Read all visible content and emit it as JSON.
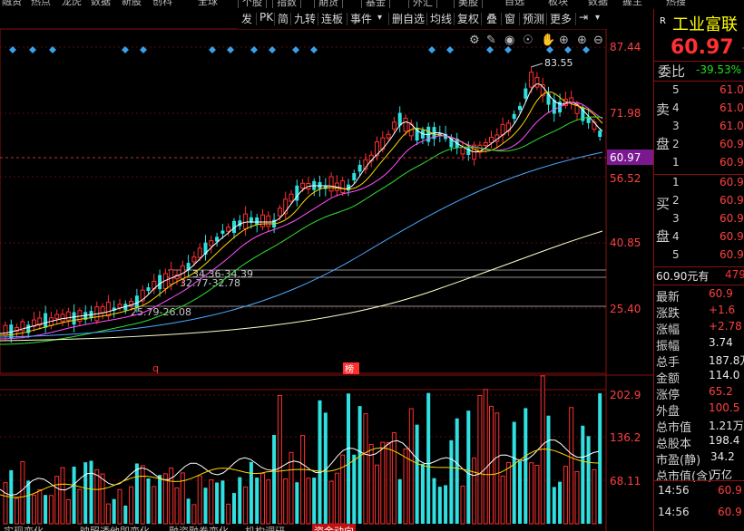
{
  "top_nav": [
    "融资",
    "热点",
    "龙虎",
    "数据",
    "新股",
    "创科",
    "全球"
  ],
  "top_nav_right": [
    "个股",
    "指数",
    "期货",
    "基金",
    "外汇",
    "美股",
    "自选",
    "板块",
    "数据",
    "握主",
    "热搜"
  ],
  "toolbar": {
    "buttons": [
      "发",
      "PK",
      "简",
      "九转",
      "连板",
      "事件",
      "▾",
      "删自选",
      "均线",
      "复权",
      "叠",
      "窗",
      "预测",
      "更多",
      "⇥",
      "▾"
    ]
  },
  "chart_icons": [
    "gear-icon",
    "pen-icon",
    "eye-icon",
    "hand-icon",
    "add-icon",
    "minus-icon"
  ],
  "price_axis": {
    "ticks": [
      "87.44",
      "71.98",
      "56.52",
      "40.85",
      "25.40"
    ],
    "current_price": "60.97",
    "max_label": "83.55"
  },
  "annotations": {
    "band1": "34.36-34.39",
    "band2": "32.77-32.78",
    "band3": "25.79-26.08"
  },
  "markers": {
    "q": "q",
    "bang": "榜"
  },
  "volume_axis": {
    "ticks": [
      "202.9",
      "136.2",
      "68.11"
    ]
  },
  "stock": {
    "badge": "R",
    "name": "工业富联",
    "price": "60.97",
    "change_prefix": "+"
  },
  "order_book": {
    "wei_bi_label": "委比",
    "wei_bi_value": "-39.53%",
    "sell_label_1": "卖",
    "sell_label_2": "盘",
    "buy_label_1": "买",
    "buy_label_2": "盘",
    "sells": [
      {
        "level": "5",
        "price": "61.0"
      },
      {
        "level": "4",
        "price": "61.0"
      },
      {
        "level": "3",
        "price": "61.0"
      },
      {
        "level": "2",
        "price": "60.9"
      },
      {
        "level": "1",
        "price": "60.9"
      }
    ],
    "buys": [
      {
        "level": "1",
        "price": "60.9"
      },
      {
        "level": "2",
        "price": "60.9"
      },
      {
        "level": "3",
        "price": "60.9"
      },
      {
        "level": "4",
        "price": "60.9"
      },
      {
        "level": "5",
        "price": "60.9"
      }
    ]
  },
  "bid_line": {
    "price": "60.90元有",
    "qty": "479"
  },
  "stats": [
    {
      "label": "最新",
      "value": "60.9",
      "color": "red"
    },
    {
      "label": "涨跌",
      "value": "+1.6",
      "color": "red"
    },
    {
      "label": "涨幅",
      "value": "+2.78",
      "color": "red"
    },
    {
      "label": "振幅",
      "value": "3.74",
      "color": "white"
    },
    {
      "label": "总手",
      "value": "187.8万",
      "color": "white"
    },
    {
      "label": "金额",
      "value": "114.0",
      "color": "white"
    },
    {
      "label": "涨停",
      "value": "65.2",
      "color": "red"
    },
    {
      "label": "外盘",
      "value": "100.5",
      "color": "red"
    },
    {
      "label": "总市值",
      "value": "1.21万",
      "color": "white"
    },
    {
      "label": "总股本",
      "value": "198.4",
      "color": "white"
    },
    {
      "label": "市盈(静)",
      "value": "34.2",
      "color": "white"
    },
    {
      "label": "总市值(含)",
      "value": "万亿",
      "color": "white"
    }
  ],
  "ticks": [
    {
      "time": "14:56",
      "price": "60.9"
    },
    {
      "time": "14:56",
      "price": "60.9"
    }
  ],
  "bottom_bar": [
    "实现变化",
    "映照透他即变化",
    "融资融券变化",
    "机构调研",
    "资金动向"
  ],
  "colors": {
    "up": "#ff3030",
    "down": "#30e0e0",
    "ma5": "#ffffff",
    "ma10": "#ffd700",
    "ma20": "#ff50ff",
    "ma30": "#30e030",
    "ma60": "#4aa8ff",
    "ma120": "#ffffcc"
  }
}
